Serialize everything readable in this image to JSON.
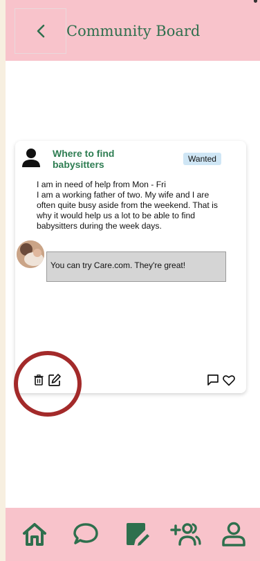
{
  "header": {
    "title": "Community Board",
    "back_icon": "chevron-left-icon"
  },
  "post": {
    "title": "Where to find babysitters",
    "tag": "Wanted",
    "body_lines": [
      "I am in need of help from Mon - Fri",
      "I am a working father of two. My wife and I are",
      "often quite busy aside from the weekend. That is",
      "why it would help us a lot to be able to find",
      "babysitters during the week days."
    ],
    "reply": "You can try Care.com. They're great!",
    "actions": [
      "trash-icon",
      "edit-icon",
      "comment-icon",
      "heart-icon"
    ]
  },
  "colors": {
    "header_bg": "#f8c3cb",
    "accent_green": "#2e6f4d",
    "tag_bg": "#cfe6f5",
    "highlight_ring": "#a32a2a"
  },
  "nav": {
    "items": [
      "home-icon",
      "chat-icon",
      "post-note-icon",
      "add-friends-icon",
      "profile-icon"
    ]
  }
}
